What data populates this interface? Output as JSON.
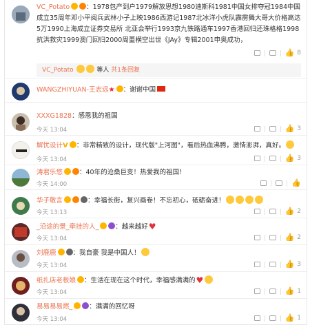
{
  "comments": [
    {
      "user": "VC_Potato",
      "text": "：1978包产到户1979解放思想1980迪斯科1981中国女排夺冠1984中国成立35周年邓小平阅兵武林小子上映1986西游记1987北冰洋小虎队霹雳舞大哥大价格高达5万1990上海成立证券交易所 北亚会举行1993京九铁路通车1997香港回归还珠格格1998抗洪救灾1999澳门回归2000周董横空出世《JAy》专辑2001申奥成功，",
      "time": "",
      "likes": "8",
      "reply_user": "VC_Potato",
      "reply_text": "等人",
      "reply_link": "共1条回复"
    },
    {
      "user": "WANGZHIYUAN-王志远",
      "text": "：谢谢中国",
      "time": "",
      "likes": ""
    },
    {
      "user": "XXXG1828",
      "text": "：感恩我的祖国",
      "time": "今天 13:04",
      "likes": "3"
    },
    {
      "user": "解忧设计",
      "text": "：非常精致的设计，现代版\"上河图\"，看后热血沸腾，激情澎湃，真好。",
      "time": "今天 13:04",
      "likes": "3"
    },
    {
      "user": "涛君乐悠",
      "text": "：40年的沧桑巨变！热爱我的祖国！",
      "time": "今天 14:00",
      "likes": ""
    },
    {
      "user": "华子敬言",
      "text": "：幸福长街，复兴画卷！不忘初心，砥砺奋进！",
      "time": "今天 13:13",
      "likes": "2"
    },
    {
      "user": "_沿途的景_牵挂的人_",
      "text": "：越来越好",
      "time": "今天 13:04",
      "likes": "2"
    },
    {
      "user": "刘鹿鹿",
      "text": "：我自豪 我是中国人！",
      "time": "今天 13:04",
      "likes": "3"
    },
    {
      "user": "纸扎店老板娘",
      "text": "：生活在现在这个时代，幸福感满满的",
      "time": "今天 13:04",
      "likes": "1"
    },
    {
      "user": "易易易易燃_",
      "text": "：满满的回忆呀",
      "time": "今天 13:04",
      "likes": "1"
    }
  ],
  "icons": {
    "share": "share-icon",
    "reply": "reply-icon",
    "like": "like-icon"
  }
}
